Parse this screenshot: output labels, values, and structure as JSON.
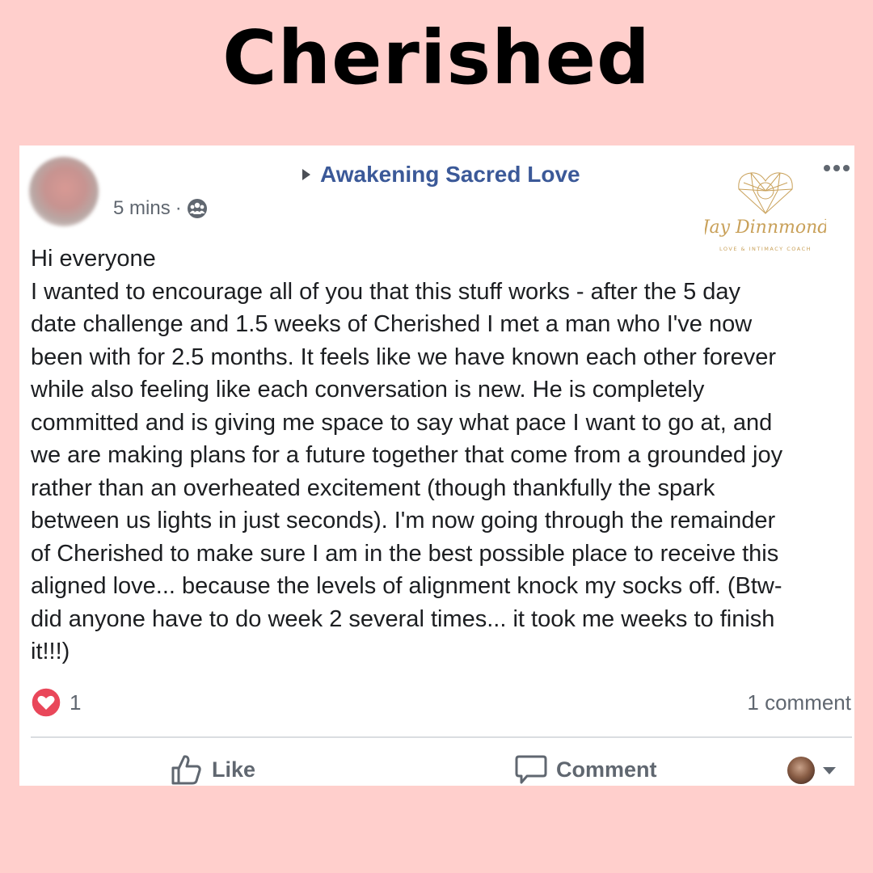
{
  "page": {
    "title": "Cherished",
    "background_color": "#ffcfcc"
  },
  "post": {
    "group_name": "Awakening Sacred Love",
    "timestamp": "5 mins",
    "separator": "·",
    "privacy_icon": "group-icon",
    "link_color": "#3b5998",
    "body_lines": [
      "Hi everyone",
      "I wanted to encourage all of you that this stuff works - after the 5 day",
      "date challenge and 1.5 weeks of Cherished I met a man who I've now",
      "been with for 2.5 months. It feels like we have known each other forever",
      "while also feeling like each conversation is new. He is completely",
      "committed and is giving me space to say what pace I want to go at, and",
      "we are making plans for a future together that come from a grounded joy",
      "rather than an overheated excitement (though thankfully the spark",
      "between us lights in just seconds). I'm now going through the remainder",
      "of Cherished to make sure I am in the best possible place to receive this",
      "aligned love... because the levels of alignment knock my socks off. (Btw-",
      "did anyone have to do week 2 several times... it took me weeks to finish",
      "it!!!)"
    ],
    "reaction_count": "1",
    "reaction_icon": "heart-icon",
    "comment_count_label": "1 comment",
    "actions": {
      "like_label": "Like",
      "comment_label": "Comment"
    }
  },
  "watermark": {
    "signature": "Jay Dinnmond",
    "tagline": "LOVE & INTIMACY COACH",
    "accent_color": "#c9a15a"
  }
}
